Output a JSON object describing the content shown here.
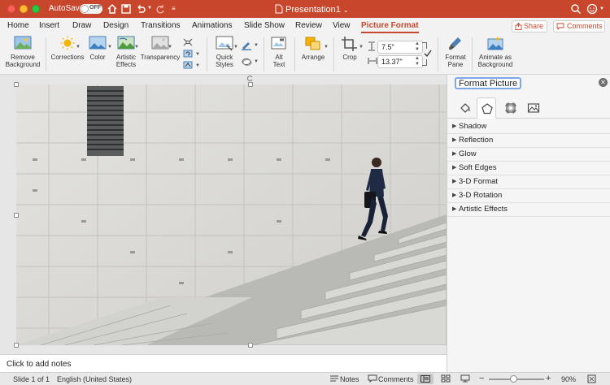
{
  "titlebar": {
    "autosave_label": "AutoSave",
    "autosave_state": "OFF",
    "doc_title": "Presentation1"
  },
  "tabs": [
    "Home",
    "Insert",
    "Draw",
    "Design",
    "Transitions",
    "Animations",
    "Slide Show",
    "Review",
    "View",
    "Picture Format"
  ],
  "active_tab": "Picture Format",
  "share_label": "Share",
  "comments_label": "Comments",
  "ribbon": {
    "remove_background": [
      "Remove",
      "Background"
    ],
    "corrections": "Corrections",
    "color": "Color",
    "artistic_effects": [
      "Artistic",
      "Effects"
    ],
    "transparency": "Transparency",
    "quick_styles": [
      "Quick",
      "Styles"
    ],
    "alt_text": [
      "Alt",
      "Text"
    ],
    "arrange": "Arrange",
    "crop": "Crop",
    "height": "7.5\"",
    "width": "13.37\"",
    "format_pane": [
      "Format",
      "Pane"
    ],
    "animate_background": [
      "Animate as",
      "Background"
    ]
  },
  "notes_placeholder": "Click to add notes",
  "pane": {
    "title": "Format Picture",
    "sections": [
      "Shadow",
      "Reflection",
      "Glow",
      "Soft Edges",
      "3-D Format",
      "3-D Rotation",
      "Artistic Effects"
    ]
  },
  "status": {
    "slide_info": "Slide 1 of 1",
    "language": "English (United States)",
    "notes": "Notes",
    "comments": "Comments",
    "zoom": "90%"
  },
  "colors": {
    "accent": "#c8462c",
    "focus_ring": "#7ea7e6"
  }
}
